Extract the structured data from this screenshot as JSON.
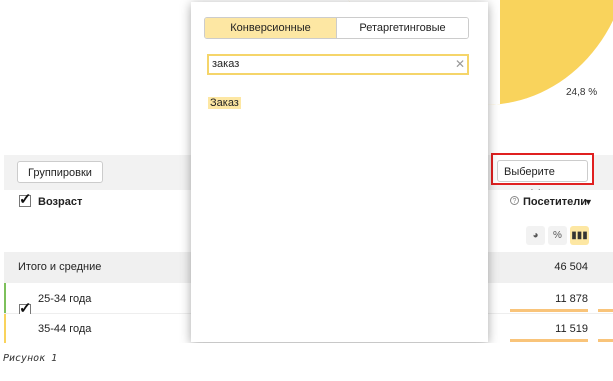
{
  "chart_data": {
    "type": "pie",
    "labels": [
      "24,8 %"
    ],
    "values": [
      24.8
    ]
  },
  "colors": {
    "accent": "#fde7a3",
    "highlight_border": "#e02020",
    "pie_main": "#f9d35c",
    "pie_other": "#5fa0e6",
    "bar": "#f9c47a"
  },
  "toolbar": {
    "groupings_label": "Группировки",
    "goal_label": "Выберите цель"
  },
  "table": {
    "dimension_header": "Возраст",
    "metric_header": "Посетители",
    "total_label": "Итого и средние",
    "total_partial": "3",
    "total_value": "46 504",
    "rows": [
      {
        "label": "25-34 года",
        "partial": "9",
        "value": "11 878",
        "color": "#7dc05b"
      },
      {
        "label": "35-44 года",
        "partial": "8",
        "value": "11 519",
        "color": "#f9d35c"
      }
    ]
  },
  "view_buttons": [
    {
      "icon": "pie-chart-icon",
      "glyph": "◕"
    },
    {
      "icon": "percent-icon",
      "glyph": "%"
    },
    {
      "icon": "bar-chart-icon",
      "glyph": "▮"
    }
  ],
  "popup": {
    "tabs": [
      {
        "label": "Конверсионные",
        "active": true
      },
      {
        "label": "Ретаргетинговые",
        "active": false
      }
    ],
    "search_value": "заказ",
    "results": [
      "Заказ"
    ]
  },
  "caption": "Рисунок 1"
}
